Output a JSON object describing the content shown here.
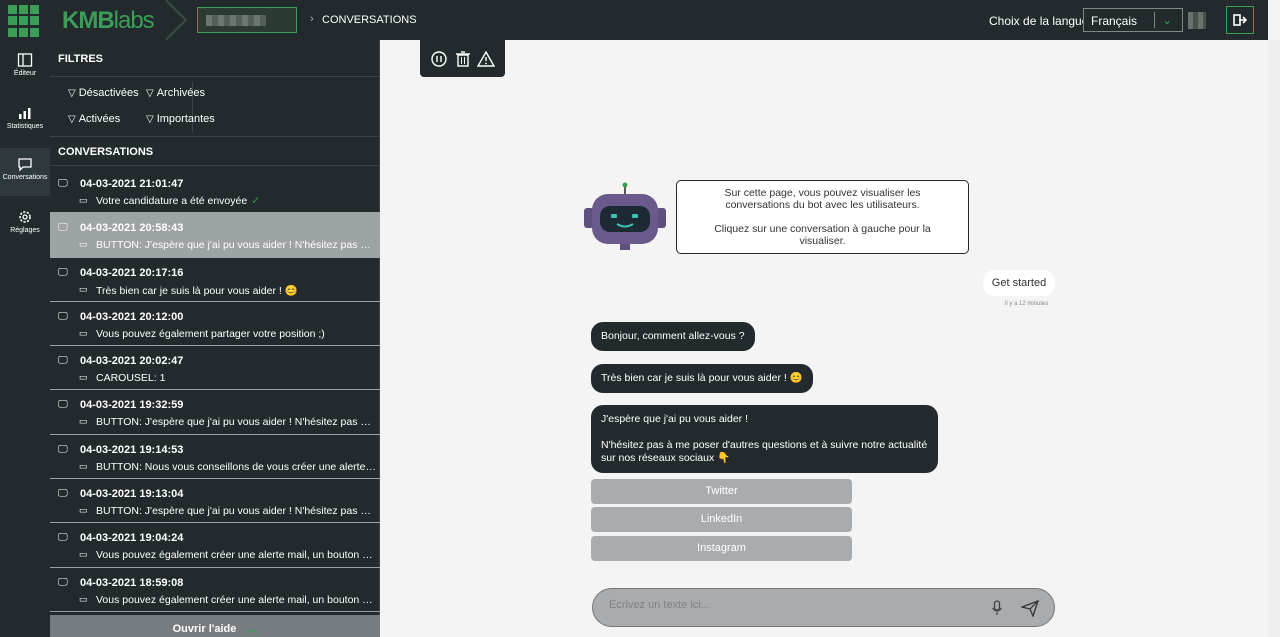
{
  "header": {
    "brand_main": "KMB",
    "brand_light": "labs",
    "breadcrumb": "CONVERSATIONS",
    "language_label": "Choix de la langue:",
    "language_value": "Français"
  },
  "sidenav": [
    {
      "label": "Éditeur",
      "icon": "editor-icon"
    },
    {
      "label": "Statistiques",
      "icon": "stats-icon"
    },
    {
      "label": "Conversations",
      "icon": "chat-icon"
    },
    {
      "label": "Réglages",
      "icon": "gear-icon"
    }
  ],
  "filters": {
    "title": "FILTRES",
    "items": [
      "Désactivées",
      "Archivées",
      "Activées",
      "Importantes"
    ]
  },
  "conversations": {
    "title": "CONVERSATIONS",
    "items": [
      {
        "date": "04-03-2021 21:01:47",
        "msg": "Votre candidature a été envoyée",
        "check": "✓"
      },
      {
        "date": "04-03-2021 20:58:43",
        "msg": "BUTTON: J'espère que j'ai pu vous aider ! N'hésitez pas à me ..."
      },
      {
        "date": "04-03-2021 20:17:16",
        "msg": "Très bien car je suis là pour vous aider ! 😊"
      },
      {
        "date": "04-03-2021 20:12:00",
        "msg": "Vous pouvez également partager votre position ;)"
      },
      {
        "date": "04-03-2021 20:02:47",
        "msg": "CAROUSEL: 1"
      },
      {
        "date": "04-03-2021 19:32:59",
        "msg": "BUTTON: J'espère que j'ai pu vous aider ! N'hésitez pas à me ..."
      },
      {
        "date": "04-03-2021 19:14:53",
        "msg": "BUTTON: Nous vous conseillons de vous créer une alerte mail..."
      },
      {
        "date": "04-03-2021 19:13:04",
        "msg": "BUTTON: J'espère que j'ai pu vous aider ! N'hésitez pas à me ..."
      },
      {
        "date": "04-03-2021 19:04:24",
        "msg": "Vous pouvez également créer une alerte mail, un bouton est ..."
      },
      {
        "date": "04-03-2021 18:59:08",
        "msg": "Vous pouvez également créer une alerte mail, un bouton est ..."
      }
    ],
    "help": "Ouvrir l'aide"
  },
  "chat": {
    "info_line1": "Sur cette page, vous pouvez visualiser les conversations du bot avec les utilisateurs.",
    "info_line2": "Cliquez sur une conversation à gauche pour la visualiser.",
    "user_msg": "Get started",
    "user_time": "il y a 12 minutes",
    "bot_msg1": "Bonjour, comment allez-vous ?",
    "bot_msg2": "Très bien car je suis là pour vous aider ! 😊",
    "bot_msg3a": "J'espère que j'ai pu vous aider !",
    "bot_msg3b": "N'hésitez pas à me poser d'autres questions et à suivre notre actualité sur nos réseaux sociaux 👇",
    "buttons": [
      "Twitter",
      "LinkedIn",
      "Instagram"
    ],
    "input_placeholder": "Écrivez un texte ici..."
  },
  "colors": {
    "accent": "#3c9d57",
    "dark": "#222a2e",
    "selected": "#9ea3a6"
  }
}
